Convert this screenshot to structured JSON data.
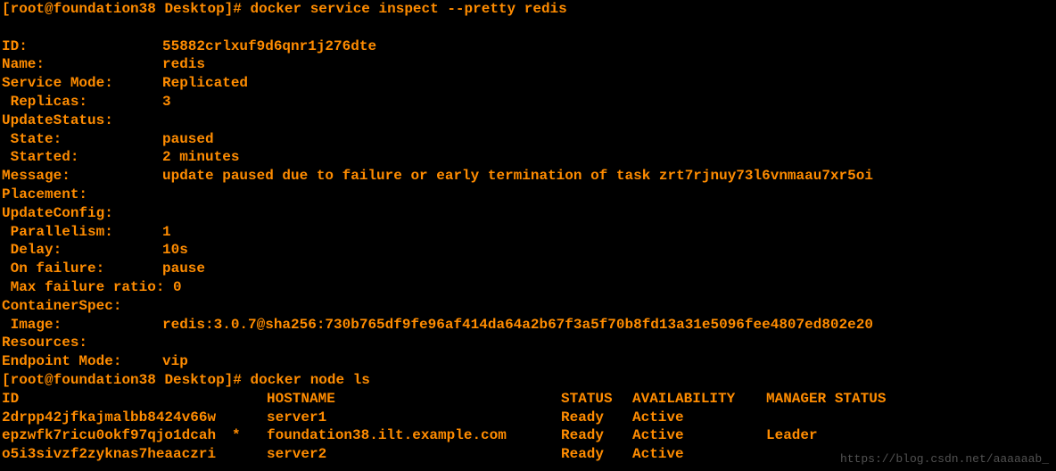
{
  "prompt": {
    "open": "[",
    "user": "root",
    "at": "@",
    "host": "foundation38",
    "path": "Desktop",
    "close": "]#"
  },
  "command1": "docker service inspect --pretty redis",
  "inspect": {
    "id_label": "ID:",
    "id_value": "55882crlxuf9d6qnr1j276dte",
    "name_label": "Name:",
    "name_value": "redis",
    "mode_label": "Service Mode:",
    "mode_value": "Replicated",
    "replicas_label": " Replicas:",
    "replicas_value": "3",
    "updatestatus_label": "UpdateStatus:",
    "state_label": " State:",
    "state_value": "paused",
    "started_label": " Started:",
    "started_value": "2 minutes",
    "message_label": "Message:",
    "message_value": "update paused due to failure or early termination of task zrt7rjnuy73l6vnmaau7xr5oi",
    "placement_label": "Placement:",
    "updateconfig_label": "UpdateConfig:",
    "parallelism_label": " Parallelism:",
    "parallelism_value": "1",
    "delay_label": " Delay:",
    "delay_value": "10s",
    "onfailure_label": " On failure:",
    "onfailure_value": "pause",
    "maxfail_label": " Max failure ratio:",
    "maxfail_value": "0",
    "containerspec_label": "ContainerSpec:",
    "image_label": " Image:",
    "image_value": "redis:3.0.7@sha256:730b765df9fe96af414da64a2b67f3a5f70b8fd13a31e5096fee4807ed802e20",
    "resources_label": "Resources:",
    "endpoint_label": "Endpoint Mode:",
    "endpoint_value": "vip"
  },
  "command2": "docker node ls",
  "nodels": {
    "header_id": "ID",
    "header_hostname": "HOSTNAME",
    "header_status": "STATUS",
    "header_availability": "AVAILABILITY",
    "header_manager": "MANAGER STATUS",
    "row1_id": "2drpp42jfkajmalbb8424v66w",
    "row1_marker": " ",
    "row1_hostname": "server1",
    "row1_status": "Ready",
    "row1_availability": "Active",
    "row1_manager": "",
    "row2_id": "epzwfk7ricu0okf97qjo1dcah",
    "row2_marker": "*",
    "row2_hostname": "foundation38.ilt.example.com",
    "row2_status": "Ready",
    "row2_availability": "Active",
    "row2_manager": "Leader",
    "row3_id": "o5i3sivzf2zyknas7heaaczri",
    "row3_marker": " ",
    "row3_hostname": "server2",
    "row3_status": "Ready",
    "row3_availability": "Active",
    "row3_manager": ""
  },
  "watermark": "https://blog.csdn.net/aaaaaab_"
}
